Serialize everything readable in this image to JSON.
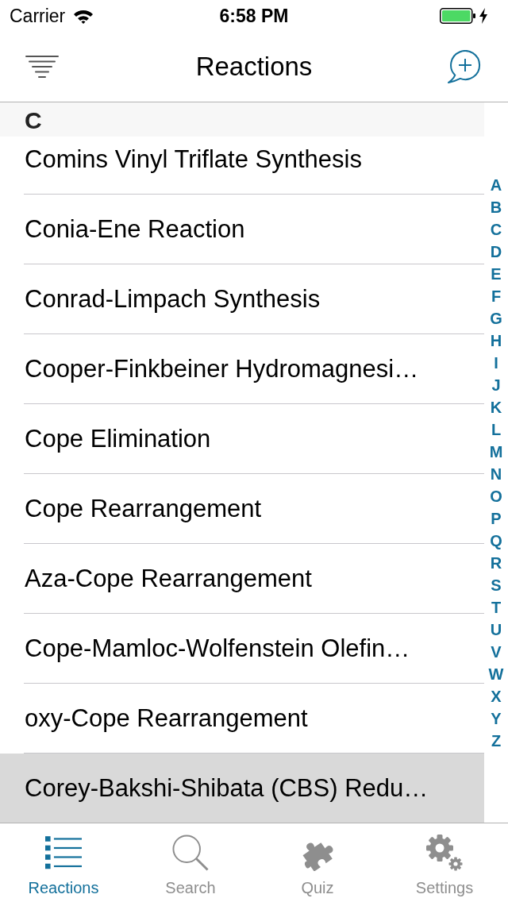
{
  "status_bar": {
    "carrier": "Carrier",
    "time": "6:58 PM",
    "charging": true
  },
  "nav_bar": {
    "title": "Reactions"
  },
  "section": {
    "header": "C",
    "rows": [
      {
        "name": "Comins Vinyl Triflate Synthesis",
        "selected": false
      },
      {
        "name": "Conia-Ene Reaction",
        "selected": false
      },
      {
        "name": "Conrad-Limpach Synthesis",
        "selected": false
      },
      {
        "name": "Cooper-Finkbeiner Hydromagnesi…",
        "selected": false
      },
      {
        "name": "Cope Elimination",
        "selected": false
      },
      {
        "name": "Cope Rearrangement",
        "selected": false
      },
      {
        "name": "Aza-Cope Rearrangement",
        "selected": false
      },
      {
        "name": "Cope-Mamloc-Wolfenstein Olefin…",
        "selected": false
      },
      {
        "name": "oxy-Cope Rearrangement",
        "selected": false
      },
      {
        "name": "Corey-Bakshi-Shibata (CBS) Redu…",
        "selected": true
      }
    ]
  },
  "section_index": [
    "A",
    "B",
    "C",
    "D",
    "E",
    "F",
    "G",
    "H",
    "I",
    "J",
    "K",
    "L",
    "M",
    "N",
    "O",
    "P",
    "Q",
    "R",
    "S",
    "T",
    "U",
    "V",
    "W",
    "X",
    "Y",
    "Z"
  ],
  "tab_bar": [
    {
      "label": "Reactions",
      "kind": "list",
      "selected": true
    },
    {
      "label": "Search",
      "kind": "search",
      "selected": false
    },
    {
      "label": "Quiz",
      "kind": "puzzle",
      "selected": false
    },
    {
      "label": "Settings",
      "kind": "gears",
      "selected": false
    }
  ]
}
